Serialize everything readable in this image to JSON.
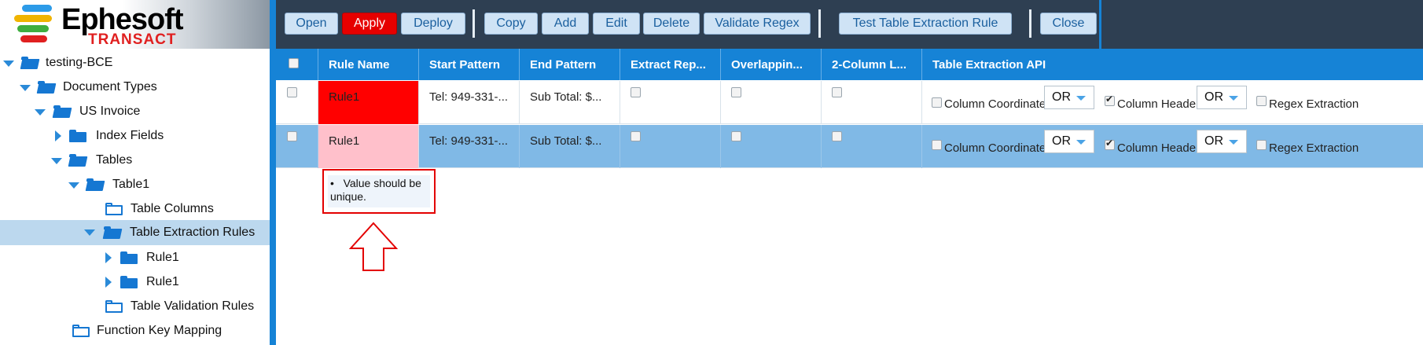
{
  "logo": {
    "brand": "Ephesoft",
    "sub": "TRANSACT"
  },
  "toolbar": {
    "open": "Open",
    "apply": "Apply",
    "deploy": "Deploy",
    "copy": "Copy",
    "add": "Add",
    "edit": "Edit",
    "delete": "Delete",
    "validate_regex": "Validate Regex",
    "test_rule": "Test Table Extraction Rule",
    "close": "Close"
  },
  "tree": {
    "items": [
      {
        "label": "testing-BCE"
      },
      {
        "label": "Document Types"
      },
      {
        "label": "US Invoice"
      },
      {
        "label": "Index Fields"
      },
      {
        "label": "Tables"
      },
      {
        "label": "Table1"
      },
      {
        "label": "Table Columns"
      },
      {
        "label": "Table Extraction Rules"
      },
      {
        "label": "Rule1"
      },
      {
        "label": "Rule1"
      },
      {
        "label": "Table Validation Rules"
      },
      {
        "label": "Function Key Mapping"
      }
    ]
  },
  "grid": {
    "headers": [
      "Rule Name",
      "Start Pattern",
      "End Pattern",
      "Extract Rep...",
      "Overlappin...",
      "2-Column L...",
      "Table Extraction API"
    ],
    "rows": [
      {
        "rule_name": "Rule1",
        "start_pattern": "Tel: 949-331-...",
        "end_pattern": "Sub Total: $...",
        "col_coords": "Column Coordinates",
        "op1": "OR",
        "col_header": "Column Header",
        "op2": "OR",
        "regex": "Regex Extraction"
      },
      {
        "rule_name": "Rule1",
        "start_pattern": "Tel: 949-331-...",
        "end_pattern": "Sub Total: $...",
        "col_coords": "Column Coordinates",
        "op1": "OR",
        "col_header": "Column Header",
        "op2": "OR",
        "regex": "Regex Extraction"
      }
    ]
  },
  "tooltip": {
    "bullet": "•",
    "text_line1": "Value should be",
    "text_line2": "unique."
  },
  "colors": {
    "header_bg": "#2e3f52",
    "accent": "#1683d6",
    "error_red": "#e60000",
    "row1_name_bg": "#ff0000",
    "row2_name_bg": "#ffc0cb",
    "selected_row_bg": "#80b9e6"
  }
}
